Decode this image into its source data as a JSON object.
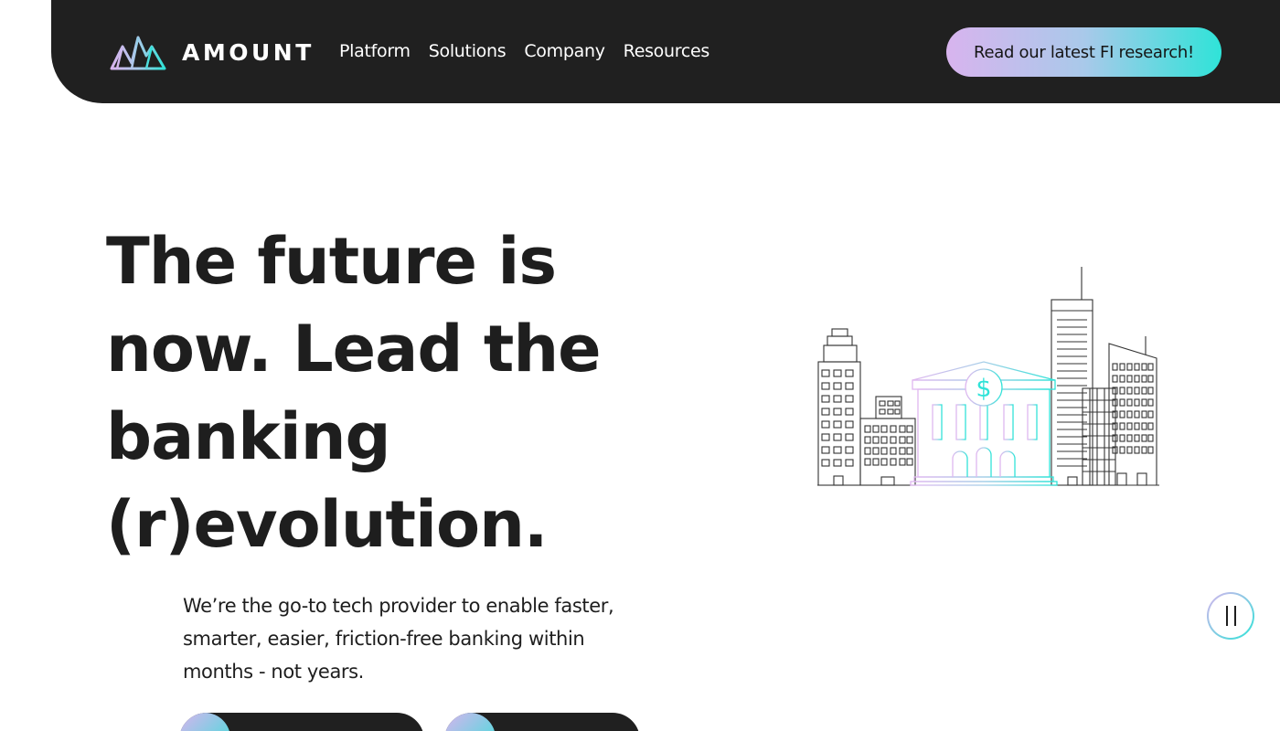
{
  "brand": {
    "name": "AMOUNT",
    "accent_colors": [
      "#d8b4ee",
      "#a9c9ea",
      "#2fe3d8"
    ],
    "nav_background": "#202020"
  },
  "nav": {
    "links": [
      {
        "label": "Platform"
      },
      {
        "label": "Solutions"
      },
      {
        "label": "Company"
      },
      {
        "label": "Resources"
      }
    ],
    "cta_label": "Read our latest FI research!"
  },
  "hero": {
    "title_lines": [
      "The future is",
      "now. Lead the",
      "banking",
      "(r)evolution."
    ],
    "subtitle": "We’re the go-to tech provider to enable faster, smarter, easier, friction-free banking within months - not years.",
    "buttons": [
      {
        "label": ""
      },
      {
        "label": ""
      }
    ]
  },
  "illustration": {
    "icon": "bank-city-illustration-icon",
    "bank_symbol": "$"
  },
  "media_control": {
    "icon": "pause-icon"
  }
}
